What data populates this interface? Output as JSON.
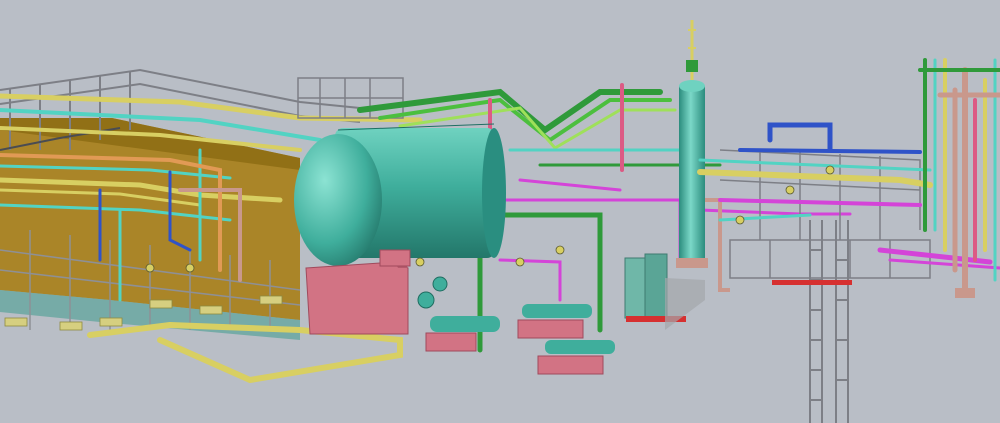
{
  "scene": {
    "kind": "3D plant piping model render",
    "background": "#b9bec6",
    "colors": {
      "structure": "#7d7f86",
      "building": "#a8801a",
      "vessel": "#3fae9c",
      "foundation": "#d27384",
      "pipe_yellow": "#d8cf62",
      "pipe_green": "#2f9a3a",
      "pipe_cyan": "#52d3c3",
      "pipe_blue": "#2f53c8",
      "pipe_magenta": "#d444d8",
      "pipe_tan": "#c9988c",
      "pipe_pink": "#dc5a84",
      "pipe_lime": "#9fe05a",
      "grating_red": "#d63030"
    }
  }
}
